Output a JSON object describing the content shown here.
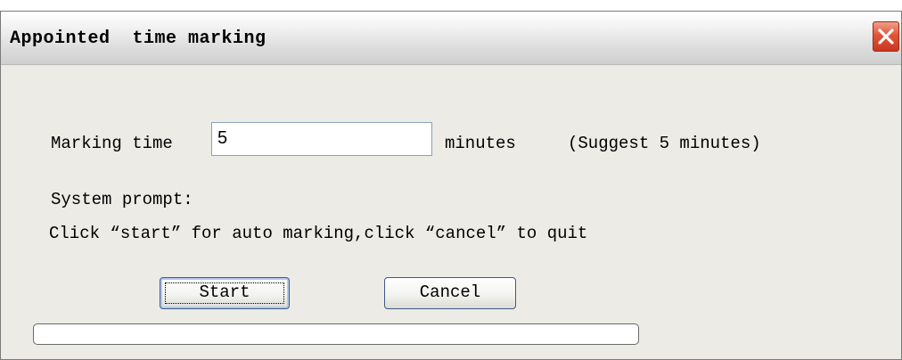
{
  "window": {
    "title": "Appointed  time marking"
  },
  "form": {
    "marking_time_label": "Marking time",
    "marking_time_value": "5",
    "minutes_label": "minutes",
    "suggest_text": "(Suggest 5 minutes)",
    "prompt_title": "System prompt:",
    "prompt_text": "Click “start” for auto marking,click “cancel” to quit"
  },
  "buttons": {
    "start_label": "Start",
    "cancel_label": "Cancel"
  },
  "progress": {
    "fraction": 0
  },
  "icons": {
    "close": "close-icon"
  },
  "colors": {
    "close_button": "#e0553a",
    "dialog_background": "#ecebe6"
  }
}
